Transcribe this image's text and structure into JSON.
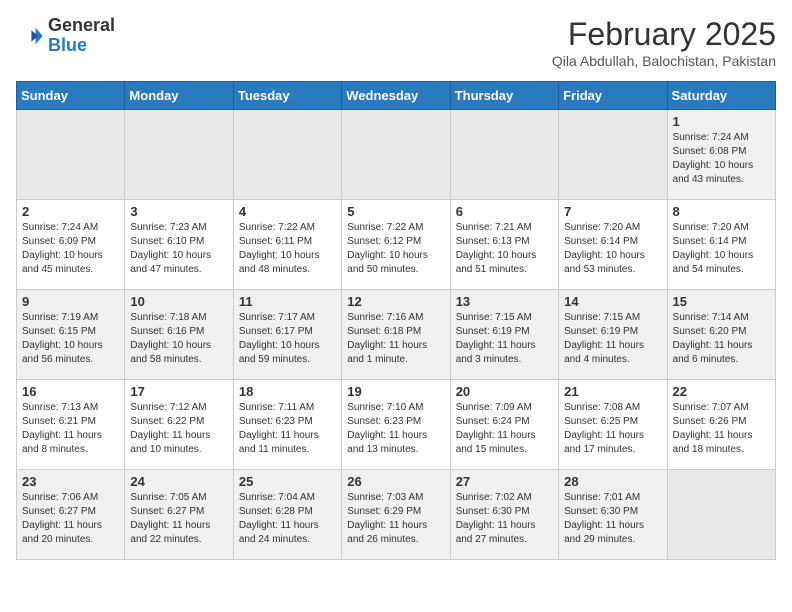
{
  "header": {
    "logo_general": "General",
    "logo_blue": "Blue",
    "month_year": "February 2025",
    "location": "Qila Abdullah, Balochistan, Pakistan"
  },
  "days_of_week": [
    "Sunday",
    "Monday",
    "Tuesday",
    "Wednesday",
    "Thursday",
    "Friday",
    "Saturday"
  ],
  "weeks": [
    [
      {
        "day": "",
        "info": ""
      },
      {
        "day": "",
        "info": ""
      },
      {
        "day": "",
        "info": ""
      },
      {
        "day": "",
        "info": ""
      },
      {
        "day": "",
        "info": ""
      },
      {
        "day": "",
        "info": ""
      },
      {
        "day": "1",
        "info": "Sunrise: 7:24 AM\nSunset: 6:08 PM\nDaylight: 10 hours\nand 43 minutes."
      }
    ],
    [
      {
        "day": "2",
        "info": "Sunrise: 7:24 AM\nSunset: 6:09 PM\nDaylight: 10 hours\nand 45 minutes."
      },
      {
        "day": "3",
        "info": "Sunrise: 7:23 AM\nSunset: 6:10 PM\nDaylight: 10 hours\nand 47 minutes."
      },
      {
        "day": "4",
        "info": "Sunrise: 7:22 AM\nSunset: 6:11 PM\nDaylight: 10 hours\nand 48 minutes."
      },
      {
        "day": "5",
        "info": "Sunrise: 7:22 AM\nSunset: 6:12 PM\nDaylight: 10 hours\nand 50 minutes."
      },
      {
        "day": "6",
        "info": "Sunrise: 7:21 AM\nSunset: 6:13 PM\nDaylight: 10 hours\nand 51 minutes."
      },
      {
        "day": "7",
        "info": "Sunrise: 7:20 AM\nSunset: 6:14 PM\nDaylight: 10 hours\nand 53 minutes."
      },
      {
        "day": "8",
        "info": "Sunrise: 7:20 AM\nSunset: 6:14 PM\nDaylight: 10 hours\nand 54 minutes."
      }
    ],
    [
      {
        "day": "9",
        "info": "Sunrise: 7:19 AM\nSunset: 6:15 PM\nDaylight: 10 hours\nand 56 minutes."
      },
      {
        "day": "10",
        "info": "Sunrise: 7:18 AM\nSunset: 6:16 PM\nDaylight: 10 hours\nand 58 minutes."
      },
      {
        "day": "11",
        "info": "Sunrise: 7:17 AM\nSunset: 6:17 PM\nDaylight: 10 hours\nand 59 minutes."
      },
      {
        "day": "12",
        "info": "Sunrise: 7:16 AM\nSunset: 6:18 PM\nDaylight: 11 hours\nand 1 minute."
      },
      {
        "day": "13",
        "info": "Sunrise: 7:15 AM\nSunset: 6:19 PM\nDaylight: 11 hours\nand 3 minutes."
      },
      {
        "day": "14",
        "info": "Sunrise: 7:15 AM\nSunset: 6:19 PM\nDaylight: 11 hours\nand 4 minutes."
      },
      {
        "day": "15",
        "info": "Sunrise: 7:14 AM\nSunset: 6:20 PM\nDaylight: 11 hours\nand 6 minutes."
      }
    ],
    [
      {
        "day": "16",
        "info": "Sunrise: 7:13 AM\nSunset: 6:21 PM\nDaylight: 11 hours\nand 8 minutes."
      },
      {
        "day": "17",
        "info": "Sunrise: 7:12 AM\nSunset: 6:22 PM\nDaylight: 11 hours\nand 10 minutes."
      },
      {
        "day": "18",
        "info": "Sunrise: 7:11 AM\nSunset: 6:23 PM\nDaylight: 11 hours\nand 11 minutes."
      },
      {
        "day": "19",
        "info": "Sunrise: 7:10 AM\nSunset: 6:23 PM\nDaylight: 11 hours\nand 13 minutes."
      },
      {
        "day": "20",
        "info": "Sunrise: 7:09 AM\nSunset: 6:24 PM\nDaylight: 11 hours\nand 15 minutes."
      },
      {
        "day": "21",
        "info": "Sunrise: 7:08 AM\nSunset: 6:25 PM\nDaylight: 11 hours\nand 17 minutes."
      },
      {
        "day": "22",
        "info": "Sunrise: 7:07 AM\nSunset: 6:26 PM\nDaylight: 11 hours\nand 18 minutes."
      }
    ],
    [
      {
        "day": "23",
        "info": "Sunrise: 7:06 AM\nSunset: 6:27 PM\nDaylight: 11 hours\nand 20 minutes."
      },
      {
        "day": "24",
        "info": "Sunrise: 7:05 AM\nSunset: 6:27 PM\nDaylight: 11 hours\nand 22 minutes."
      },
      {
        "day": "25",
        "info": "Sunrise: 7:04 AM\nSunset: 6:28 PM\nDaylight: 11 hours\nand 24 minutes."
      },
      {
        "day": "26",
        "info": "Sunrise: 7:03 AM\nSunset: 6:29 PM\nDaylight: 11 hours\nand 26 minutes."
      },
      {
        "day": "27",
        "info": "Sunrise: 7:02 AM\nSunset: 6:30 PM\nDaylight: 11 hours\nand 27 minutes."
      },
      {
        "day": "28",
        "info": "Sunrise: 7:01 AM\nSunset: 6:30 PM\nDaylight: 11 hours\nand 29 minutes."
      },
      {
        "day": "",
        "info": ""
      }
    ]
  ]
}
